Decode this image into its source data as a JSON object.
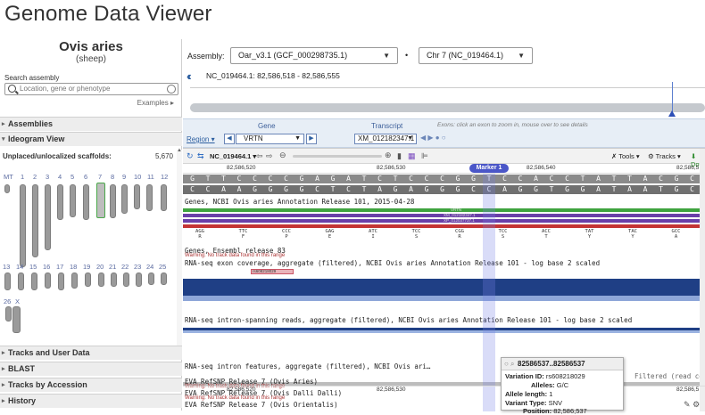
{
  "page": {
    "title": "Genome Data Viewer"
  },
  "organism": {
    "name": "Ovis aries",
    "common": "(sheep)"
  },
  "search": {
    "label": "Search assembly",
    "placeholder": "Location, gene or phenotype",
    "examples": "Examples ▸"
  },
  "sidebar": {
    "assemblies": "Assemblies",
    "ideogram": "Ideogram View",
    "unplaced_label": "Unplaced/unlocalized scaffolds:",
    "unplaced_count": "5,670",
    "row1": [
      "MT",
      "1",
      "2",
      "3",
      "4",
      "5",
      "6",
      "7",
      "8",
      "9",
      "10",
      "11",
      "12"
    ],
    "row2": [
      "13",
      "14",
      "15",
      "16",
      "17",
      "18",
      "19",
      "20",
      "21",
      "22",
      "23",
      "24",
      "25"
    ],
    "row3": [
      "26",
      "X"
    ],
    "bottom": [
      "Tracks and User Data",
      "BLAST",
      "Tracks by Accession",
      "History"
    ]
  },
  "assembly": {
    "label": "Assembly:",
    "value": "Oar_v3.1 (GCF_000298735.1)",
    "chrom": "Chr 7 (NC_019464.1)"
  },
  "coords": {
    "text": "NC_019464.1: 82,586,518 - 82,586,555"
  },
  "gene_bar": {
    "gene_label": "Gene",
    "transcript_label": "Transcript",
    "hint": "Exons: click an exon to zoom in, mouse over to see details",
    "region": "Region",
    "gene": "VRTN",
    "transcript": "XM_012182347.1"
  },
  "toolbar": {
    "accession": "NC_019464.1",
    "tools": "Tools",
    "tracks": "Tracks",
    "download": "Do"
  },
  "ruler": [
    "82,586,520",
    "82,586,530",
    "82,586,540",
    "82,586,5"
  ],
  "marker": "Marker 1",
  "seq_top": [
    "G",
    "T",
    "T",
    "C",
    "C",
    "C",
    "C",
    "G",
    "A",
    "G",
    "A",
    "T",
    "C",
    "T",
    "C",
    "C",
    "C",
    "G",
    "G",
    "T",
    "C",
    "C",
    "A",
    "C",
    "C",
    "T",
    "A",
    "T",
    "T",
    "A",
    "C",
    "G",
    "C"
  ],
  "seq_bottom": [
    "C",
    "C",
    "A",
    "A",
    "G",
    "G",
    "G",
    "G",
    "C",
    "T",
    "C",
    "T",
    "A",
    "G",
    "A",
    "G",
    "G",
    "G",
    "C",
    "C",
    "A",
    "G",
    "G",
    "T",
    "G",
    "G",
    "A",
    "T",
    "A",
    "A",
    "T",
    "G",
    "C"
  ],
  "tracks": {
    "ncbi_genes": "Genes, NCBI Ovis aries Annotation Release 101, 2015-04-28",
    "ensembl": "Genes, Ensembl release 83",
    "warn": "Warning: No track data found in this range",
    "rnaseq_exon": "RNA-seq exon coverage, aggregate (filtered), NCBI Ovis aries Annotation Release 101 - log base 2 scaled",
    "rnaseq_intron": "RNA-seq intron-spanning reads, aggregate (filtered), NCBI Ovis aries Annotation Release 101 - log base 2 scaled",
    "intron_features": "RNA-seq intron features, aggregate (filtered), NCBI Ovis ari…",
    "filtered": "Filtered (read cou",
    "evar1": "EVA RefSNP Release 7 (Ovis Aries)",
    "evar2": "EVA RefSNP Release 7 (Ovis Dalli Dalli)",
    "evar3": "EVA RefSNP Release 7 (Ovis Orientalis)",
    "snp_id": "rs608218029",
    "gene_tag": "VRTN",
    "tr_tag1": "XM_012182347.1",
    "tr_tag2": "XP_012037737.1"
  },
  "aa": {
    "codons": [
      "AGG",
      "TTC",
      "CCC",
      "GAG",
      "ATC",
      "TCC",
      "CGG",
      "TCC",
      "ACC",
      "TAT",
      "TAC",
      "GCC"
    ],
    "letters": [
      "R",
      "F",
      "P",
      "E",
      "I",
      "S",
      "R",
      "S",
      "T",
      "Y",
      "Y",
      "A"
    ]
  },
  "tooltip": {
    "title": "82586537..82586537",
    "rows": [
      {
        "k": "Variation ID:",
        "v": "rs608218029"
      },
      {
        "k": "Alleles:",
        "v": "G/C"
      },
      {
        "k": "Allele length:",
        "v": "1"
      },
      {
        "k": "Variant Type:",
        "v": "SNV"
      },
      {
        "k": "Position:",
        "v": "82,586,537"
      }
    ]
  },
  "colors": {
    "accent": "#2d5fa0",
    "highlight": "#7882e6",
    "gene_green": "#3fa33f",
    "transcript_purple": "#6a3fa8"
  }
}
